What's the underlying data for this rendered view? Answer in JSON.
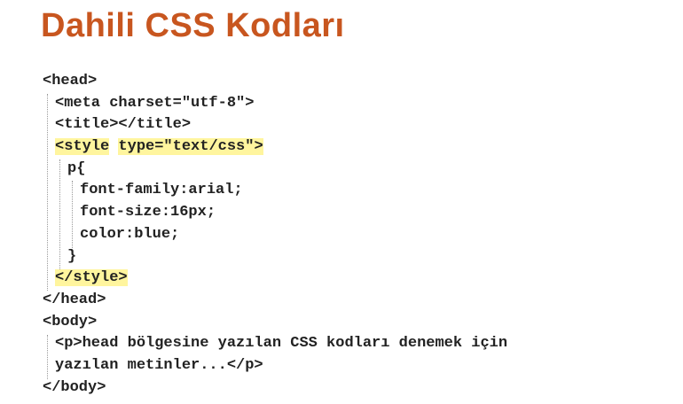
{
  "title": "Dahili CSS Kodları",
  "code_lines": {
    "l0": "<head>",
    "l1": "<meta charset=\"utf-8\">",
    "l2": "<title></title>",
    "l3a": "<style",
    "l3b": "type=\"text/css\">",
    "l4": "p{",
    "l5": "font-family:arial;",
    "l6": "font-size:16px;",
    "l7": "color:blue;",
    "l8": "}",
    "l9": "</style>",
    "l10": "</head>",
    "l11": "<body>",
    "l12": "<p>head bölgesine yazılan CSS kodları denemek için",
    "l13": "yazılan metinler...</p>",
    "l14": "</body>"
  },
  "highlight_color": "#fff59e",
  "title_color": "#c8561f"
}
